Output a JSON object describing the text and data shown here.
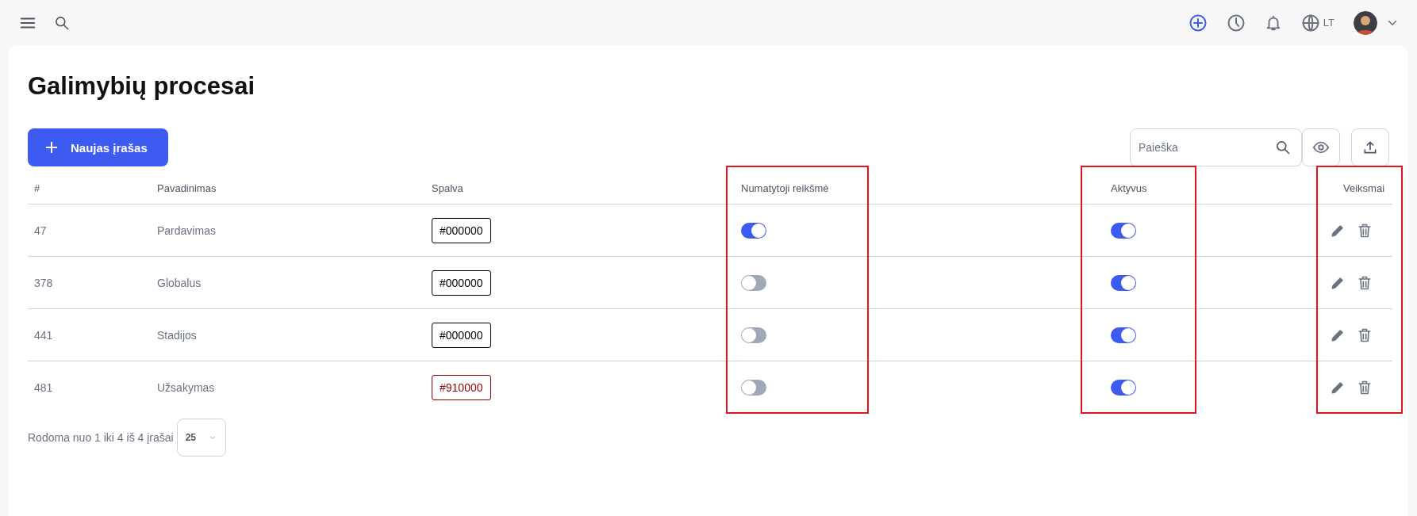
{
  "topbar": {
    "language": "LT"
  },
  "page": {
    "title": "Galimybių procesai"
  },
  "toolbar": {
    "new_button": "Naujas įrašas",
    "search": {
      "placeholder": "Paieška"
    }
  },
  "table": {
    "columns": [
      {
        "label": "#",
        "kind": "id",
        "highlighted": false
      },
      {
        "label": "Pavadinimas",
        "kind": "name",
        "highlighted": false
      },
      {
        "label": "Spalva",
        "kind": "color",
        "highlighted": false
      },
      {
        "label": "Numatytoji reikšmė",
        "kind": "default",
        "highlighted": true
      },
      {
        "label": "Aktyvus",
        "kind": "active",
        "highlighted": true
      },
      {
        "label": "Veiksmai",
        "kind": "actions",
        "highlighted": true
      }
    ],
    "rows": [
      {
        "id": "47",
        "name": "Pardavimas",
        "color_code": "#000000",
        "color": "#000000",
        "default": true,
        "active": true
      },
      {
        "id": "378",
        "name": "Globalus",
        "color_code": "#000000",
        "color": "#000000",
        "default": false,
        "active": true
      },
      {
        "id": "441",
        "name": "Stadijos",
        "color_code": "#000000",
        "color": "#000000",
        "default": false,
        "active": true
      },
      {
        "id": "481",
        "name": "Užsakymas",
        "color_code": "#910000",
        "color": "#910000",
        "default": false,
        "active": true
      }
    ]
  },
  "pagination": {
    "summary": "Rodoma nuo 1 iki 4 iš 4 įrašai",
    "page_size": "25"
  }
}
